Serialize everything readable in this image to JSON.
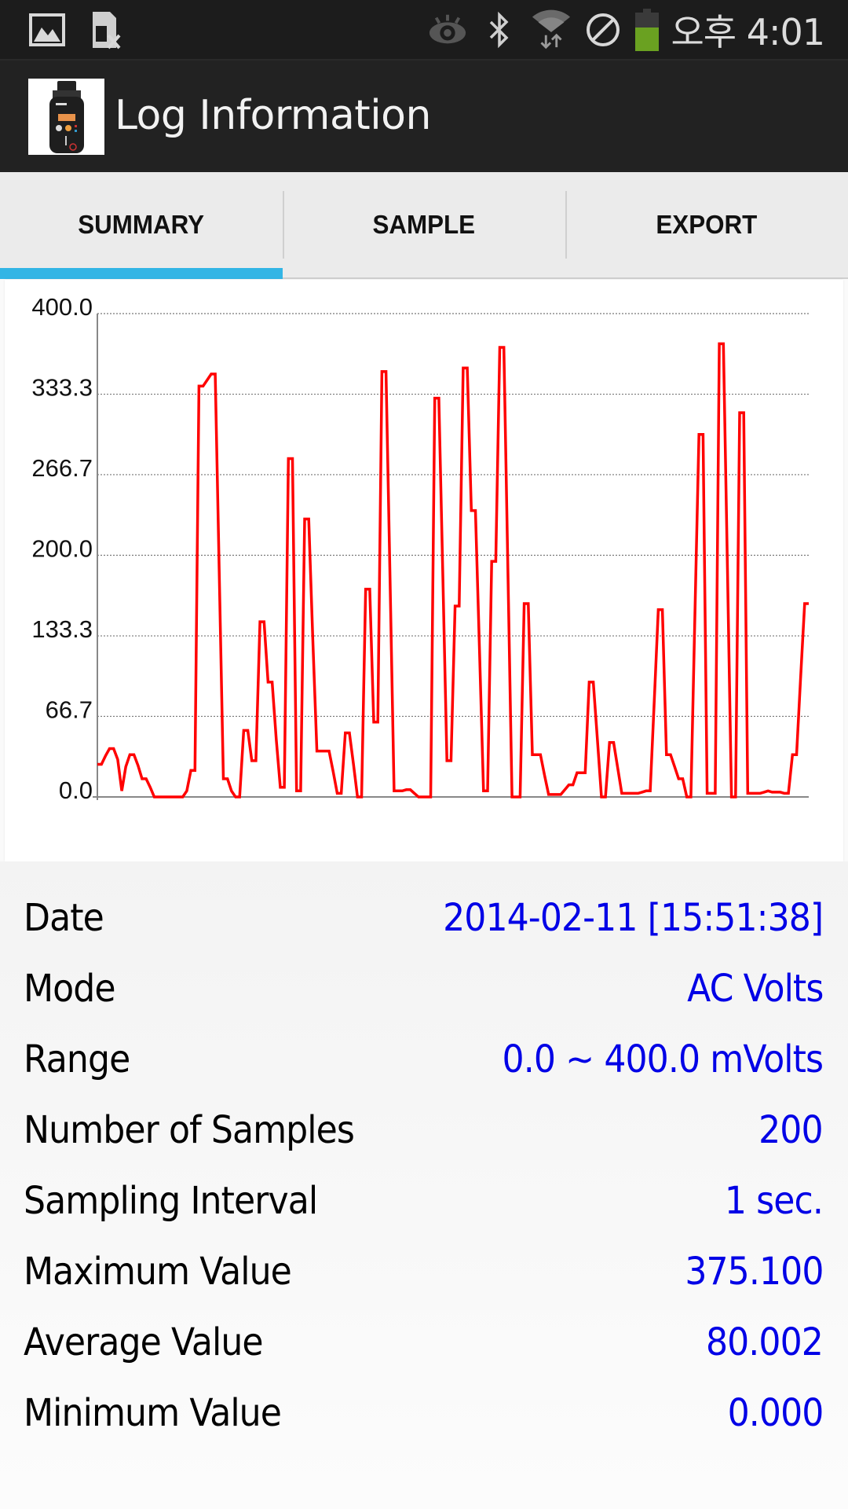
{
  "status_bar": {
    "left_icons": [
      "image-icon",
      "sim-card-disabled-icon"
    ],
    "right_icons": [
      "eye-icon",
      "bluetooth-icon",
      "wifi-icon",
      "blocked-icon",
      "battery-icon"
    ],
    "time": "오후 4:01",
    "battery_color": "#6aa121"
  },
  "action_bar": {
    "title": "Log Information",
    "app_icon": "multimeter-device-icon"
  },
  "tabs": [
    {
      "label": "SUMMARY",
      "active": true
    },
    {
      "label": "SAMPLE",
      "active": false
    },
    {
      "label": "EXPORT",
      "active": false
    }
  ],
  "colors": {
    "accent": "#33b5e5",
    "line": "#ff0000",
    "value_text": "#0000e6"
  },
  "chart_data": {
    "type": "line",
    "title": "",
    "xlabel": "",
    "ylabel": "",
    "ylim": [
      0,
      400
    ],
    "xlim": [
      0,
      199
    ],
    "y_ticks": [
      "400.0",
      "333.3",
      "266.7",
      "200.0",
      "133.3",
      "66.7",
      "0.0"
    ],
    "y_tick_values": [
      400,
      333.3,
      266.7,
      200,
      133.3,
      66.7,
      0
    ],
    "grid": "horizontal-dotted",
    "legend": "none",
    "series": [
      {
        "name": "AC Volts",
        "color": "#ff0000",
        "values": [
          27,
          27,
          34,
          40,
          40,
          31,
          5,
          25,
          35,
          35,
          26,
          15,
          15,
          8,
          0,
          0,
          0,
          0,
          0,
          0,
          0,
          0,
          5,
          22,
          22,
          340,
          340,
          345,
          350,
          350,
          183,
          15,
          15,
          5,
          0,
          0,
          55,
          55,
          30,
          30,
          145,
          145,
          95,
          95,
          48,
          8,
          8,
          280,
          280,
          5,
          5,
          230,
          230,
          130,
          38,
          38,
          38,
          38,
          21,
          3,
          3,
          53,
          53,
          27,
          0,
          0,
          172,
          172,
          62,
          62,
          352,
          352,
          179,
          5,
          5,
          5,
          6,
          6,
          3,
          0,
          0,
          0,
          0,
          330,
          330,
          180,
          30,
          30,
          158,
          158,
          355,
          355,
          237,
          237,
          121,
          5,
          5,
          195,
          195,
          372,
          372,
          186,
          0,
          0,
          0,
          160,
          160,
          35,
          35,
          35,
          18,
          2,
          2,
          2,
          2,
          6,
          10,
          10,
          20,
          20,
          20,
          95,
          95,
          48,
          0,
          0,
          45,
          45,
          24,
          3,
          3,
          3,
          3,
          3,
          4,
          5,
          5,
          80,
          155,
          155,
          35,
          35,
          25,
          15,
          15,
          0,
          0,
          150,
          300,
          300,
          3,
          3,
          3,
          375,
          375,
          188,
          0,
          0,
          318,
          318,
          3,
          3,
          3,
          3,
          4,
          5,
          4,
          4,
          4,
          3,
          3,
          35,
          35,
          98,
          160,
          160
        ]
      }
    ]
  },
  "info": [
    {
      "label": "Date",
      "value": "2014-02-11  [15:51:38]"
    },
    {
      "label": "Mode",
      "value": "AC Volts"
    },
    {
      "label": "Range",
      "value": "0.0 ~ 400.0 mVolts"
    },
    {
      "label": "Number of Samples",
      "value": "200"
    },
    {
      "label": "Sampling Interval",
      "value": "1 sec."
    },
    {
      "label": "Maximum Value",
      "value": "375.100"
    },
    {
      "label": "Average Value",
      "value": "80.002"
    },
    {
      "label": "Minimum Value",
      "value": "0.000"
    }
  ]
}
